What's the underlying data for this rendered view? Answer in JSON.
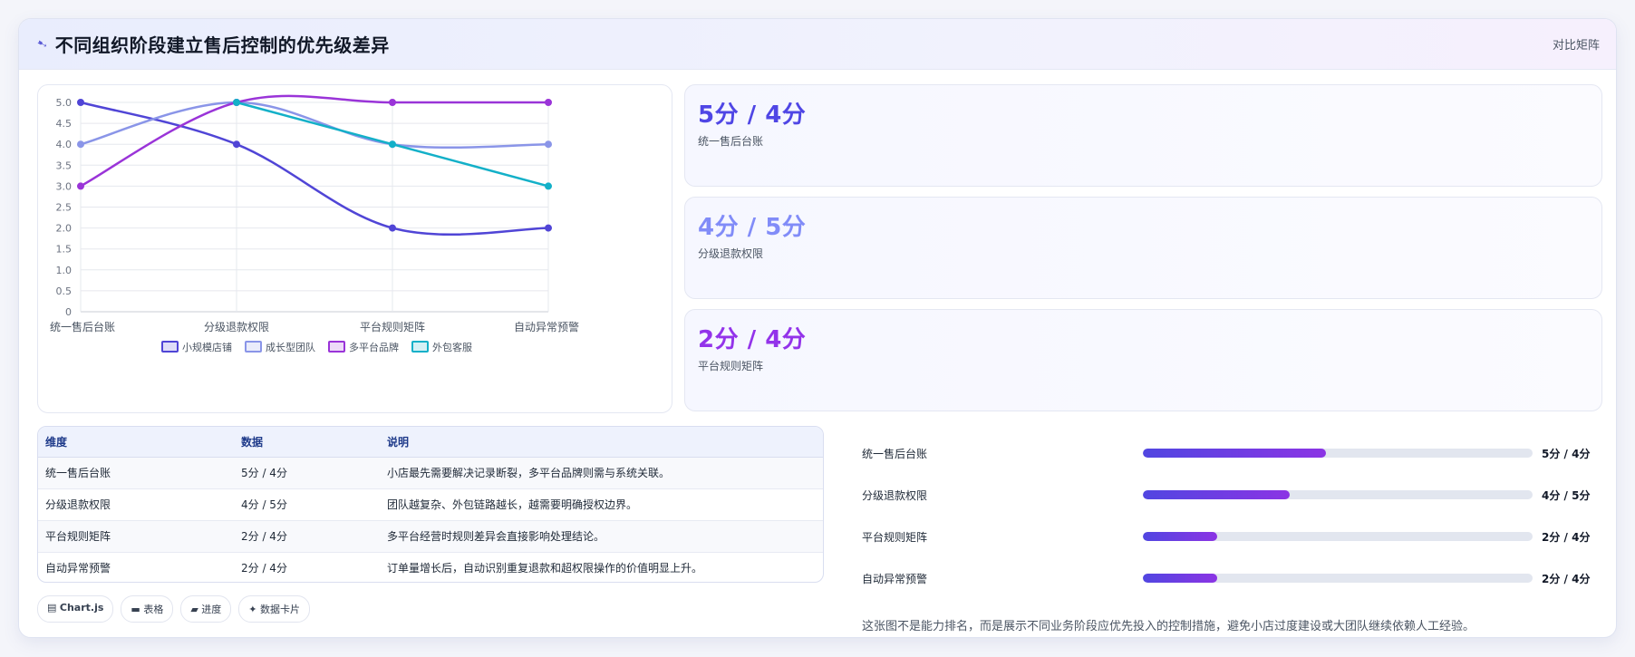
{
  "header": {
    "title": "不同组织阶段建立售后控制的优先级差异",
    "icon": "sparkle-icon",
    "link_label": "对比矩阵"
  },
  "chart_data": {
    "type": "line",
    "categories": [
      "统一售后台账",
      "分级退款权限",
      "平台规则矩阵",
      "自动异常预警"
    ],
    "ylim": [
      0,
      5
    ],
    "yticks": [
      "0",
      "0.5",
      "1.0",
      "1.5",
      "2.0",
      "2.5",
      "3.0",
      "3.5",
      "4.0",
      "4.5",
      "5.0"
    ],
    "legend_position": "bottom",
    "grid": true,
    "series": [
      {
        "name": "小规模店铺",
        "values": [
          5,
          4,
          2,
          2
        ],
        "color": "#5045d6"
      },
      {
        "name": "成长型团队",
        "values": [
          4,
          5,
          4,
          4
        ],
        "color": "#8a95e8"
      },
      {
        "name": "多平台品牌",
        "values": [
          3,
          5,
          5,
          5
        ],
        "color": "#9a34d8"
      },
      {
        "name": "外包客服",
        "values": [
          null,
          5,
          4,
          3
        ],
        "color": "#13b0c8"
      }
    ]
  },
  "stats": [
    {
      "value": "5分 / 4分",
      "label": "统一售后台账",
      "color": "#4f46e5"
    },
    {
      "value": "4分 / 5分",
      "label": "分级退款权限",
      "color": "#818cf8"
    },
    {
      "value": "2分 / 4分",
      "label": "平台规则矩阵",
      "color": "#9333ea"
    }
  ],
  "table": {
    "headers": [
      "维度",
      "数据",
      "说明"
    ],
    "rows": [
      [
        "统一售后台账",
        "5分 / 4分",
        "小店最先需要解决记录断裂，多平台品牌则需与系统关联。"
      ],
      [
        "分级退款权限",
        "4分 / 5分",
        "团队越复杂、外包链路越长，越需要明确授权边界。"
      ],
      [
        "平台规则矩阵",
        "2分 / 4分",
        "多平台经营时规则差异会直接影响处理结论。"
      ],
      [
        "自动异常预警",
        "2分 / 4分",
        "订单量增长后，自动识别重复退款和超权限操作的价值明显上升。"
      ]
    ]
  },
  "chips": [
    {
      "icon": "chart-icon",
      "glyph": "▤",
      "label": "Chart.js"
    },
    {
      "icon": "table-icon",
      "glyph": "▬",
      "label": "表格"
    },
    {
      "icon": "progress-icon",
      "glyph": "▰",
      "label": "进度"
    },
    {
      "icon": "card-icon",
      "glyph": "✦",
      "label": "数据卡片"
    }
  ],
  "progress": [
    {
      "label": "统一售后台账",
      "value": "5分 / 4分",
      "fraction": 0.47
    },
    {
      "label": "分级退款权限",
      "value": "4分 / 5分",
      "fraction": 0.377
    },
    {
      "label": "平台规则矩阵",
      "value": "2分 / 4分",
      "fraction": 0.19
    },
    {
      "label": "自动异常预警",
      "value": "2分 / 4分",
      "fraction": 0.19
    }
  ],
  "footnote": "这张图不是能力排名，而是展示不同业务阶段应优先投入的控制措施，避免小店过度建设或大团队继续依赖人工经验。"
}
